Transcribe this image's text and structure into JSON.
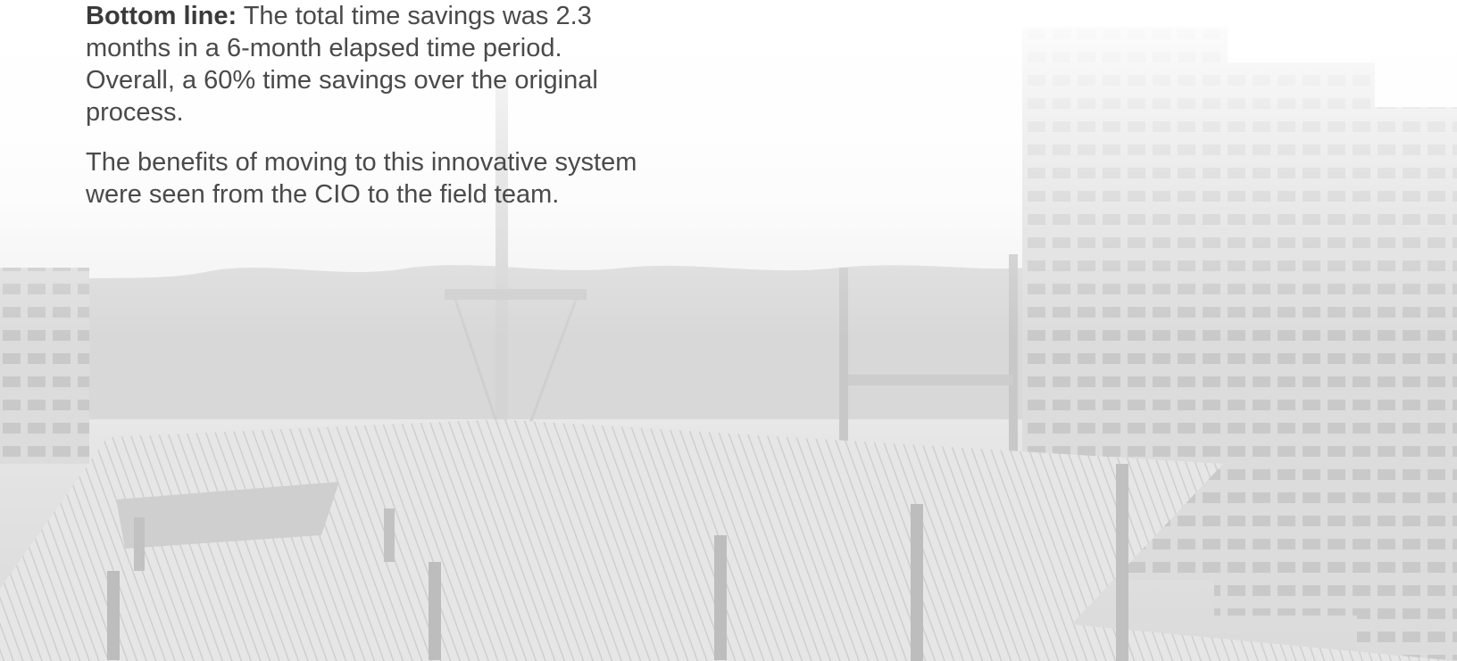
{
  "content": {
    "paragraph1": {
      "lead": "Bottom line:",
      "body": " The total time savings was 2.3 months in a 6-month elapsed time period. Overall, a 60% time savings over the original process."
    },
    "paragraph2": {
      "body": "The benefits of moving to this innovative system were seen from the CIO to the field team."
    }
  },
  "background": {
    "icon": "construction-site-photo"
  }
}
